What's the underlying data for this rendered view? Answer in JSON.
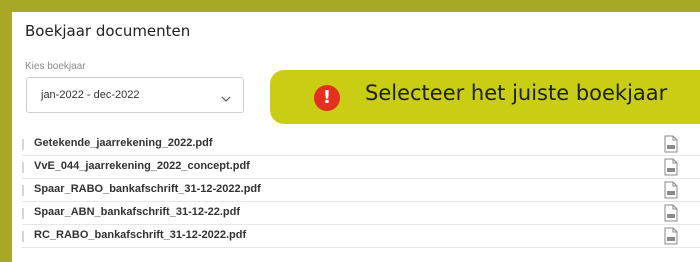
{
  "header": {
    "title": "Boekjaar documenten"
  },
  "year_select": {
    "label": "Kies boekjaar",
    "value": "jan-2022 - dec-2022",
    "icon": "chevron-down-icon"
  },
  "callout": {
    "text": "Selecteer het juiste boekjaar",
    "icon": "alert-icon",
    "glyph": "!",
    "bg_color": "#c9ce15",
    "icon_color": "#e3301f"
  },
  "documents": [
    {
      "name": "Getekende_jaarrekening_2022.pdf",
      "icon": "pdf-icon"
    },
    {
      "name": "VvE_044_jaarrekening_2022_concept.pdf",
      "icon": "pdf-icon"
    },
    {
      "name": "Spaar_RABO_bankafschrift_31-12-2022.pdf",
      "icon": "pdf-icon"
    },
    {
      "name": "Spaar_ABN_bankafschrift_31-12-22.pdf",
      "icon": "pdf-icon"
    },
    {
      "name": "RC_RABO_bankafschrift_31-12-2022.pdf",
      "icon": "pdf-icon"
    }
  ],
  "theme": {
    "frame_color": "#a6a826"
  }
}
